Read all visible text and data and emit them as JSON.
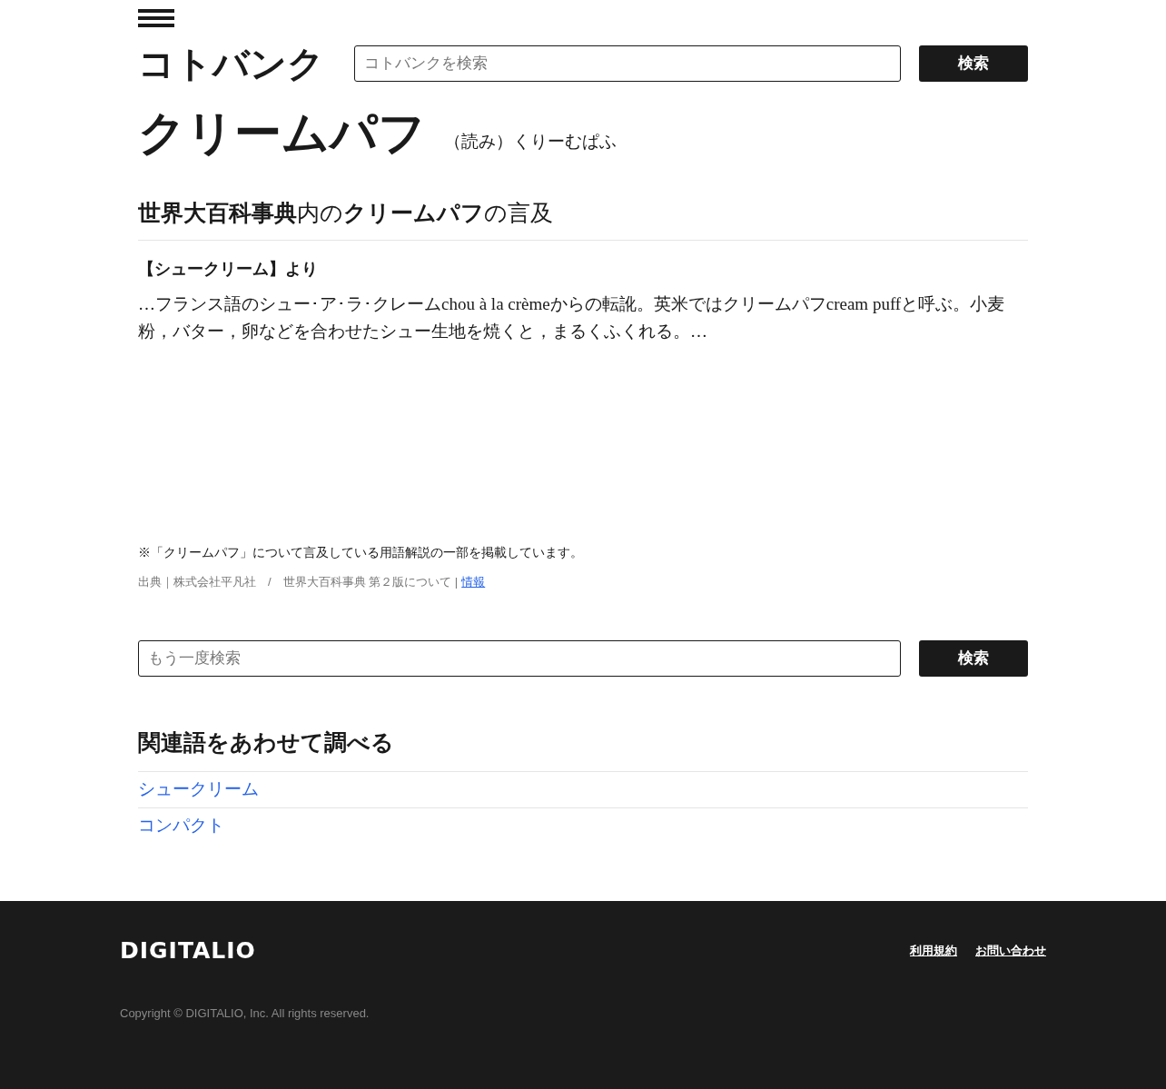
{
  "header": {
    "logo": "コトバンク",
    "search": {
      "placeholder": "コトバンクを検索"
    },
    "search_button": "検索"
  },
  "entry": {
    "title": "クリームパフ",
    "reading": "（読み）くりーむぱふ"
  },
  "mention": {
    "heading": "**世界大百科事典**内の**クリームパフ**の言及",
    "source_heading": "【シュークリーム】より",
    "excerpt": "…フランス語のシュー･ア･ラ･クレームchou à la crèmeからの転訛。英米ではクリームパフcream puffと呼ぶ。小麦粉，バター，卵などを合わせたシュー生地を焼くと，まるくふくれる。…",
    "note": "※「クリームパフ」について言及している用語解説の一部を掲載しています。",
    "credit": "出典｜株式会社平凡社　/　世界大百科事典 第２版について |",
    "credit_link": "情報"
  },
  "search_again": {
    "placeholder": "もう一度検索",
    "button": "検索"
  },
  "related": {
    "heading": "関連語をあわせて調べる",
    "items": [
      "シュークリーム",
      "コンパクト"
    ]
  },
  "footer": {
    "logo": "DIGITALIO",
    "links": [
      "利用規約",
      "お問い合わせ"
    ],
    "copyright": "Copyright © DIGITALIO, Inc. All rights reserved."
  }
}
